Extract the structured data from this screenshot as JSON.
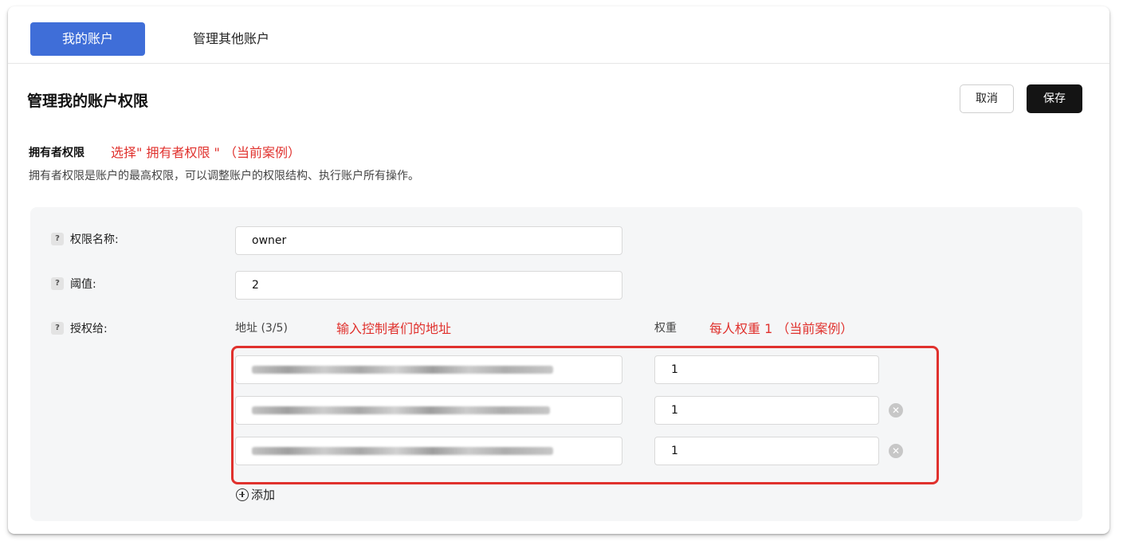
{
  "tabs": {
    "active": "我的账户",
    "other": "管理其他账户"
  },
  "header": {
    "title": "管理我的账户权限",
    "cancel_label": "取消",
    "save_label": "保存"
  },
  "section": {
    "title": "拥有者权限",
    "annotation": "选择\" 拥有者权限 \" （当前案例）",
    "description": "拥有者权限是账户的最高权限，可以调整账户的权限结构、执行账户所有操作。"
  },
  "form": {
    "permission_name": {
      "label": "权限名称:",
      "value": "owner"
    },
    "threshold": {
      "label": "阈值:",
      "value": "2"
    },
    "authorize": {
      "label": "授权给:",
      "address_header": "地址 (3/5)",
      "weight_header": "权重",
      "address_annotation": "输入控制者们的地址",
      "weight_annotation": "每人权重 1 （当前案例）",
      "rows": [
        {
          "weight": "1",
          "removable": false
        },
        {
          "weight": "1",
          "removable": true
        },
        {
          "weight": "1",
          "removable": true
        }
      ],
      "add_label": "添加"
    }
  },
  "icons": {
    "help": "question-icon",
    "remove": "remove-circle-icon",
    "add": "plus-circle-icon"
  },
  "colors": {
    "primary": "#3f6ed8",
    "annotation": "#e0312d",
    "save": "#141414"
  }
}
